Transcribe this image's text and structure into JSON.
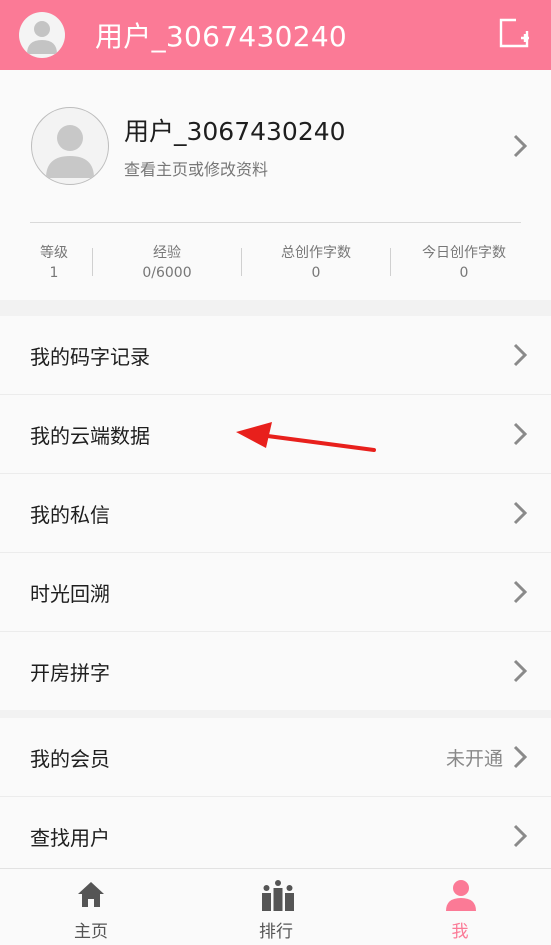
{
  "header": {
    "title": "用户_3067430240",
    "avatar_icon": "default-avatar-icon",
    "compose_icon": "add-note-icon"
  },
  "profile": {
    "name": "用户_3067430240",
    "subtitle": "查看主页或修改资料",
    "stats": [
      {
        "label": "等级",
        "value": "1"
      },
      {
        "label": "经验",
        "value": "0/6000"
      },
      {
        "label": "总创作字数",
        "value": "0"
      },
      {
        "label": "今日创作字数",
        "value": "0"
      }
    ]
  },
  "menu1": [
    {
      "label": "我的码字记录"
    },
    {
      "label": "我的云端数据"
    },
    {
      "label": "我的私信"
    },
    {
      "label": "时光回溯"
    },
    {
      "label": "开房拼字"
    }
  ],
  "menu2": [
    {
      "label": "我的会员",
      "value": "未开通"
    },
    {
      "label": "查找用户"
    }
  ],
  "nav": [
    {
      "label": "主页",
      "icon": "home-icon"
    },
    {
      "label": "排行",
      "icon": "ranking-icon"
    },
    {
      "label": "我",
      "icon": "user-icon",
      "active": true
    }
  ],
  "colors": {
    "accent": "#fb7a96",
    "arrow": "#e8201c"
  }
}
